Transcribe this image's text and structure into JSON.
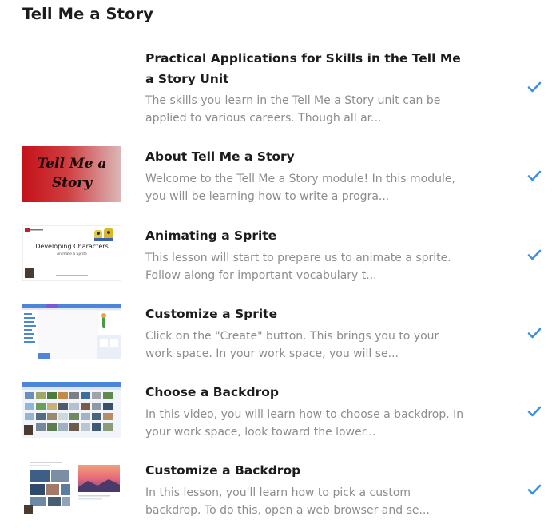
{
  "unit": {
    "title": "Tell Me a Story"
  },
  "lessons": [
    {
      "title": "Practical Applications for Skills in the Tell Me a Story Unit",
      "description": "The skills you learn in the Tell Me a Story unit can be applied to various careers. Though all ar...",
      "thumbnail": "none",
      "completed": true
    },
    {
      "title": "About Tell Me a Story",
      "description": "Welcome to the Tell Me a Story module! In this module, you will be learning how to write a progra...",
      "thumbnail": "tell-me-a-story-banner",
      "thumbnail_text": "Tell Me a Story",
      "completed": true
    },
    {
      "title": "Animating a Sprite",
      "description": "This lesson will start to prepare us to animate a sprite. Follow along for important vocabulary t...",
      "thumbnail": "developing-characters-slide",
      "thumbnail_text": "Developing Characters",
      "thumbnail_subtext": "Animate a Sprite",
      "completed": true
    },
    {
      "title": "Customize a Sprite",
      "description": "Click on the \"Create\" button. This brings you to your work space. In your work space, you will se...",
      "thumbnail": "scratch-editor-screenshot",
      "completed": true
    },
    {
      "title": "Choose a Backdrop",
      "description": "In this video, you will learn how to choose a backdrop. In your work space, look toward the lower...",
      "thumbnail": "backdrop-library-screenshot",
      "completed": true
    },
    {
      "title": "Customize a Backdrop",
      "description": "In this lesson, you'll learn how to pick a custom backdrop. To do this, open a web browser and se...",
      "thumbnail": "image-search-screenshot",
      "completed": true
    }
  ],
  "colors": {
    "check": "#3d8fe0",
    "title": "#1c1c1c",
    "description": "#8d8d8d"
  }
}
